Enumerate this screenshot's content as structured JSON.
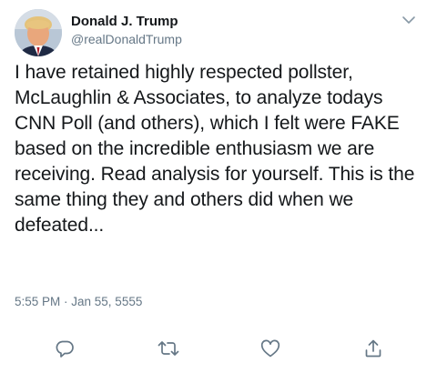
{
  "author": {
    "display_name": "Donald J. Trump",
    "handle": "@realDonaldTrump",
    "avatar_icon": "profile-photo"
  },
  "tweet": {
    "text": "I have retained highly respected pollster, McLaughlin & Associates, to analyze todays CNN Poll (and others), which I felt were FAKE based on the incredible enthusiasm we are receiving. Read analysis for yourself. This is the same thing they and others did when we defeated...",
    "timestamp": "5:55 PM · Jan 55, 5555"
  },
  "actions": [
    {
      "name": "reply",
      "icon": "reply-icon"
    },
    {
      "name": "retweet",
      "icon": "retweet-icon"
    },
    {
      "name": "like",
      "icon": "heart-icon"
    },
    {
      "name": "share",
      "icon": "share-icon"
    }
  ],
  "colors": {
    "text": "#14171a",
    "secondary": "#657786",
    "icon": "#657786"
  }
}
